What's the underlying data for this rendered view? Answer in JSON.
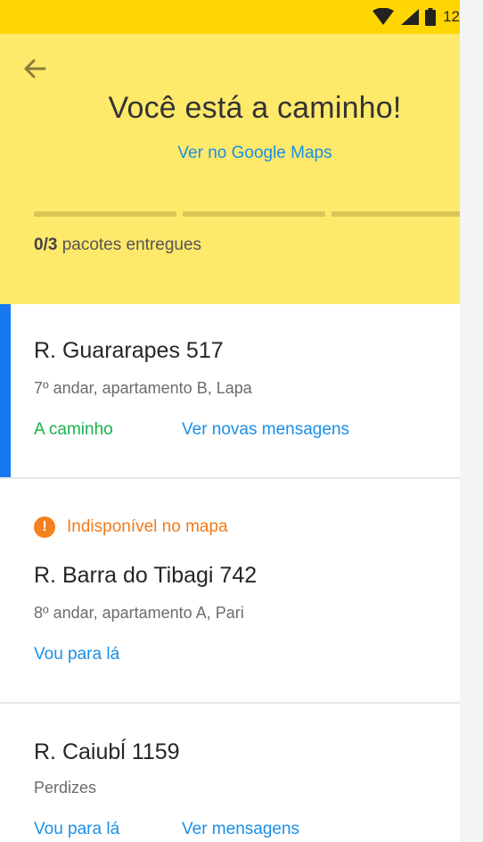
{
  "status_bar": {
    "time": "12",
    "icons": [
      "wifi-icon",
      "signal-icon",
      "battery-icon"
    ],
    "background": "#ffd602"
  },
  "header": {
    "title": "Você está a caminho!",
    "maps_link": "Ver no Google Maps",
    "progress": {
      "segments": 3,
      "completed": 0
    },
    "delivered_count": "0/3",
    "delivered_label": "pacotes entregues",
    "background": "#ffe96b"
  },
  "deliveries": [
    {
      "street": "R. Guararapes 517",
      "detail": "7º andar, apartamento B, Lapa",
      "status": "A caminho",
      "action": "Ver novas mensagens",
      "active": true
    },
    {
      "warning": "Indisponível no mapa",
      "street": "R. Barra do Tibagi 742",
      "detail": "8º andar, apartamento A, Pari",
      "action": "Vou para lá"
    },
    {
      "street": "R. Caiubĺ 1159",
      "detail": "Perdizes",
      "action": "Vou para lá",
      "secondary_action": "Ver mensagens"
    }
  ],
  "colors": {
    "link": "#1a8fe6",
    "active_indicator": "#1677f0",
    "status_green": "#19b24b",
    "warning": "#f4811f"
  }
}
